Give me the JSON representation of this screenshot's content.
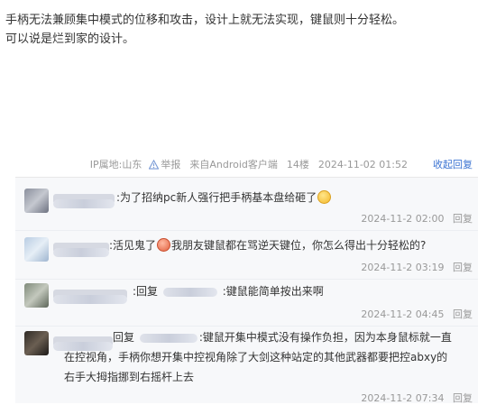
{
  "post": {
    "lines": [
      "手柄无法兼顾集中模式的位移和攻击，设计上就无法实现，键鼠则十分轻松。",
      "可以说是烂到家的设计。"
    ],
    "meta": {
      "ip_location": "IP属地:山东",
      "report_label": "举报",
      "source": "来自Android客户端",
      "floor": "14楼",
      "timestamp": "2024-11-02 01:52",
      "fold_reply_label": "收起回复"
    }
  },
  "replies": [
    {
      "text": ":为了招纳pc新人强行把手柄基本盘给砸了",
      "emoji": "smile-emoji",
      "date": "2024-11-2 02:00",
      "reply_label": "回复"
    },
    {
      "text_before": ":活见鬼了",
      "emoji": "ghost-emoji",
      "text_after": "我朋友键鼠都在骂逆天键位，你怎么得出十分轻松的?",
      "date": "2024-11-2 03:19",
      "reply_label": "回复"
    },
    {
      "prefix": ":回复",
      "text": ":键鼠能简单按出来啊",
      "date": "2024-11-2 04:45",
      "reply_label": "回复"
    },
    {
      "prefix": "回复",
      "lines": [
        ":键鼠开集中模式没有操作负担，因为本身鼠标就一直",
        "在控视角，手柄你想开集中控视角除了大剑这种站定的其他武器都要把控abxy的",
        "右手大拇指挪到右摇杆上去"
      ],
      "date": "2024-11-2 07:34",
      "reply_label": "回复"
    }
  ],
  "colors": {
    "link_blue": "#3b73d2",
    "meta_gray": "#999999",
    "reply_bg": "#f7f8fa"
  }
}
